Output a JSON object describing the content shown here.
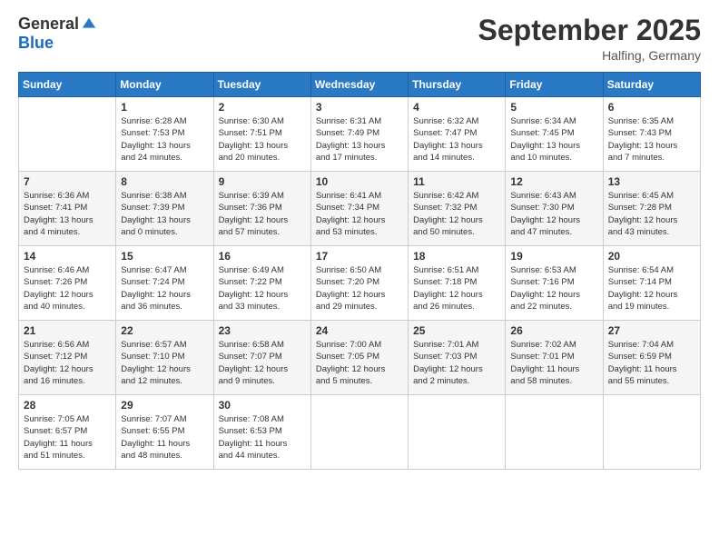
{
  "logo": {
    "general": "General",
    "blue": "Blue"
  },
  "title": "September 2025",
  "location": "Halfing, Germany",
  "days_of_week": [
    "Sunday",
    "Monday",
    "Tuesday",
    "Wednesday",
    "Thursday",
    "Friday",
    "Saturday"
  ],
  "weeks": [
    [
      {
        "day": "",
        "info": ""
      },
      {
        "day": "1",
        "info": "Sunrise: 6:28 AM\nSunset: 7:53 PM\nDaylight: 13 hours\nand 24 minutes."
      },
      {
        "day": "2",
        "info": "Sunrise: 6:30 AM\nSunset: 7:51 PM\nDaylight: 13 hours\nand 20 minutes."
      },
      {
        "day": "3",
        "info": "Sunrise: 6:31 AM\nSunset: 7:49 PM\nDaylight: 13 hours\nand 17 minutes."
      },
      {
        "day": "4",
        "info": "Sunrise: 6:32 AM\nSunset: 7:47 PM\nDaylight: 13 hours\nand 14 minutes."
      },
      {
        "day": "5",
        "info": "Sunrise: 6:34 AM\nSunset: 7:45 PM\nDaylight: 13 hours\nand 10 minutes."
      },
      {
        "day": "6",
        "info": "Sunrise: 6:35 AM\nSunset: 7:43 PM\nDaylight: 13 hours\nand 7 minutes."
      }
    ],
    [
      {
        "day": "7",
        "info": "Sunrise: 6:36 AM\nSunset: 7:41 PM\nDaylight: 13 hours\nand 4 minutes."
      },
      {
        "day": "8",
        "info": "Sunrise: 6:38 AM\nSunset: 7:39 PM\nDaylight: 13 hours\nand 0 minutes."
      },
      {
        "day": "9",
        "info": "Sunrise: 6:39 AM\nSunset: 7:36 PM\nDaylight: 12 hours\nand 57 minutes."
      },
      {
        "day": "10",
        "info": "Sunrise: 6:41 AM\nSunset: 7:34 PM\nDaylight: 12 hours\nand 53 minutes."
      },
      {
        "day": "11",
        "info": "Sunrise: 6:42 AM\nSunset: 7:32 PM\nDaylight: 12 hours\nand 50 minutes."
      },
      {
        "day": "12",
        "info": "Sunrise: 6:43 AM\nSunset: 7:30 PM\nDaylight: 12 hours\nand 47 minutes."
      },
      {
        "day": "13",
        "info": "Sunrise: 6:45 AM\nSunset: 7:28 PM\nDaylight: 12 hours\nand 43 minutes."
      }
    ],
    [
      {
        "day": "14",
        "info": "Sunrise: 6:46 AM\nSunset: 7:26 PM\nDaylight: 12 hours\nand 40 minutes."
      },
      {
        "day": "15",
        "info": "Sunrise: 6:47 AM\nSunset: 7:24 PM\nDaylight: 12 hours\nand 36 minutes."
      },
      {
        "day": "16",
        "info": "Sunrise: 6:49 AM\nSunset: 7:22 PM\nDaylight: 12 hours\nand 33 minutes."
      },
      {
        "day": "17",
        "info": "Sunrise: 6:50 AM\nSunset: 7:20 PM\nDaylight: 12 hours\nand 29 minutes."
      },
      {
        "day": "18",
        "info": "Sunrise: 6:51 AM\nSunset: 7:18 PM\nDaylight: 12 hours\nand 26 minutes."
      },
      {
        "day": "19",
        "info": "Sunrise: 6:53 AM\nSunset: 7:16 PM\nDaylight: 12 hours\nand 22 minutes."
      },
      {
        "day": "20",
        "info": "Sunrise: 6:54 AM\nSunset: 7:14 PM\nDaylight: 12 hours\nand 19 minutes."
      }
    ],
    [
      {
        "day": "21",
        "info": "Sunrise: 6:56 AM\nSunset: 7:12 PM\nDaylight: 12 hours\nand 16 minutes."
      },
      {
        "day": "22",
        "info": "Sunrise: 6:57 AM\nSunset: 7:10 PM\nDaylight: 12 hours\nand 12 minutes."
      },
      {
        "day": "23",
        "info": "Sunrise: 6:58 AM\nSunset: 7:07 PM\nDaylight: 12 hours\nand 9 minutes."
      },
      {
        "day": "24",
        "info": "Sunrise: 7:00 AM\nSunset: 7:05 PM\nDaylight: 12 hours\nand 5 minutes."
      },
      {
        "day": "25",
        "info": "Sunrise: 7:01 AM\nSunset: 7:03 PM\nDaylight: 12 hours\nand 2 minutes."
      },
      {
        "day": "26",
        "info": "Sunrise: 7:02 AM\nSunset: 7:01 PM\nDaylight: 11 hours\nand 58 minutes."
      },
      {
        "day": "27",
        "info": "Sunrise: 7:04 AM\nSunset: 6:59 PM\nDaylight: 11 hours\nand 55 minutes."
      }
    ],
    [
      {
        "day": "28",
        "info": "Sunrise: 7:05 AM\nSunset: 6:57 PM\nDaylight: 11 hours\nand 51 minutes."
      },
      {
        "day": "29",
        "info": "Sunrise: 7:07 AM\nSunset: 6:55 PM\nDaylight: 11 hours\nand 48 minutes."
      },
      {
        "day": "30",
        "info": "Sunrise: 7:08 AM\nSunset: 6:53 PM\nDaylight: 11 hours\nand 44 minutes."
      },
      {
        "day": "",
        "info": ""
      },
      {
        "day": "",
        "info": ""
      },
      {
        "day": "",
        "info": ""
      },
      {
        "day": "",
        "info": ""
      }
    ]
  ]
}
